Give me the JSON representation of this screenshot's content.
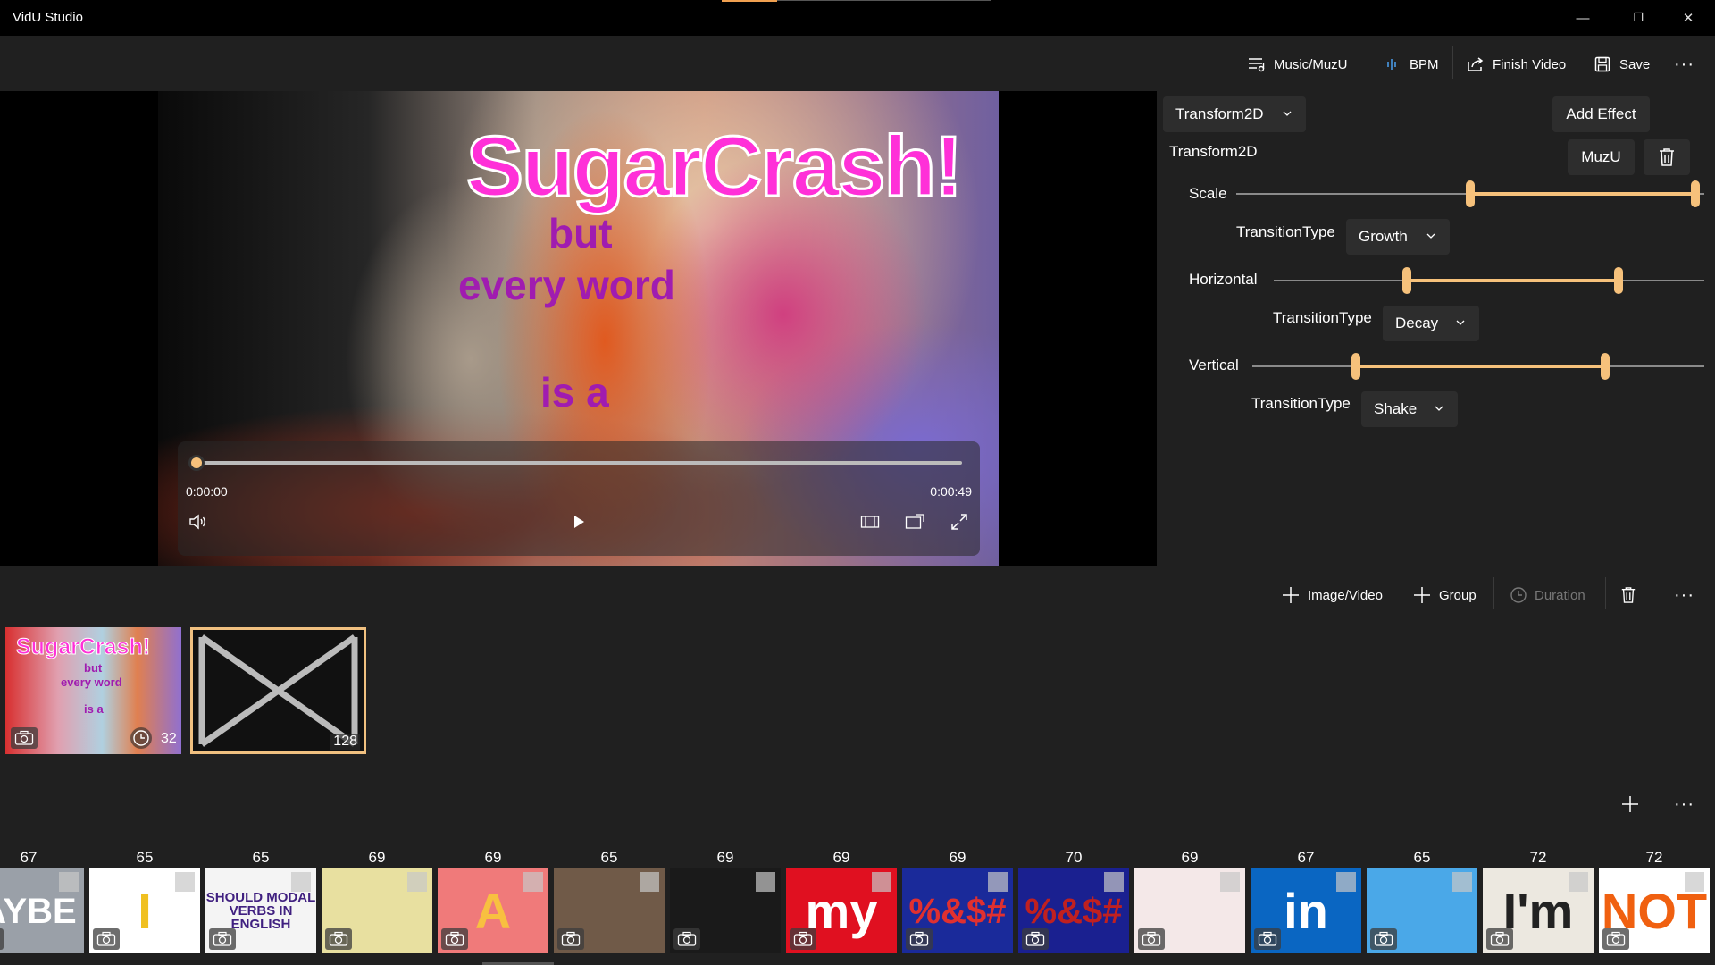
{
  "window": {
    "title": "VidU Studio",
    "minimize": "—",
    "restore": "❐",
    "close": "✕"
  },
  "toolbar": {
    "music_label": "Music/MuzU",
    "bpm_label": "BPM",
    "finish_label": "Finish Video",
    "save_label": "Save",
    "more": "···"
  },
  "preview": {
    "overlay": [
      "SugarCrash!",
      "but",
      "every word",
      "is a"
    ],
    "time_current": "0:00:00",
    "time_total": "0:00:49",
    "progress": 0
  },
  "effect": {
    "selected": "Transform2D",
    "add_label": "Add Effect",
    "name": "Transform2D",
    "muzu_label": "MuzU",
    "params": [
      {
        "label": "Scale",
        "transition_label": "TransitionType",
        "transition": "Growth",
        "low": 0.5,
        "high": 0.98
      },
      {
        "label": "Horizontal",
        "transition_label": "TransitionType",
        "transition": "Decay",
        "low": 0.31,
        "high": 0.8
      },
      {
        "label": "Vertical",
        "transition_label": "TransitionType",
        "transition": "Shake",
        "low": 0.23,
        "high": 0.78
      }
    ]
  },
  "sequence": {
    "add_media": "Image/Video",
    "add_group": "Group",
    "duration": "Duration",
    "more": "···",
    "clips": [
      {
        "text": [
          "SugarCrash!",
          "but",
          "every word",
          "is a"
        ],
        "count": "32"
      },
      {
        "count": "128"
      }
    ]
  },
  "library": {
    "more": "···",
    "add": "+",
    "items": [
      {
        "num": "67",
        "label": "AYBE",
        "bg": "#9aa0a8",
        "fg": "#ffffff"
      },
      {
        "num": "65",
        "label": "I",
        "bg": "#ffffff",
        "fg": "#f0c020"
      },
      {
        "num": "65",
        "label": "SHOULD MODAL VERBS IN ENGLISH",
        "bg": "#f4f4f4",
        "fg": "#402080"
      },
      {
        "num": "69",
        "label": "",
        "bg": "#e8e0a0",
        "fg": "#333333"
      },
      {
        "num": "69",
        "label": "A",
        "bg": "#f07a7a",
        "fg": "#f8c040"
      },
      {
        "num": "65",
        "label": "",
        "bg": "#705a48",
        "fg": "#ffffff"
      },
      {
        "num": "69",
        "label": "",
        "bg": "#1a1a1a",
        "fg": "#e03030"
      },
      {
        "num": "69",
        "label": "my",
        "bg": "#e01020",
        "fg": "#ffffff"
      },
      {
        "num": "69",
        "label": "%&$#",
        "bg": "#1a2a9a",
        "fg": "#e03030"
      },
      {
        "num": "70",
        "label": "%&$#",
        "bg": "#1a2090",
        "fg": "#c02020"
      },
      {
        "num": "69",
        "label": "",
        "bg": "#f4e8e8",
        "fg": "#d07070"
      },
      {
        "num": "67",
        "label": "in",
        "bg": "#0a66c2",
        "fg": "#ffffff"
      },
      {
        "num": "65",
        "label": "",
        "bg": "#4aa8e8",
        "fg": "#ffffff"
      },
      {
        "num": "72",
        "label": "I'm",
        "bg": "#ece8e0",
        "fg": "#222222"
      },
      {
        "num": "72",
        "label": "NOT",
        "bg": "#ffffff",
        "fg": "#f06010"
      }
    ]
  }
}
